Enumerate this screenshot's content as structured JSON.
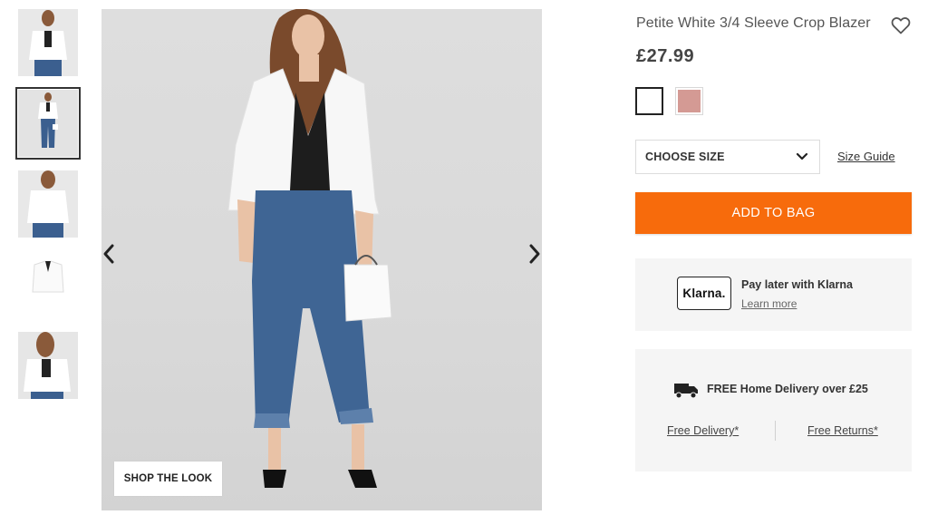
{
  "product": {
    "title": "Petite White 3/4 Sleeve Crop Blazer",
    "price": "£27.99",
    "colors": [
      {
        "name": "white",
        "hex": "#ffffff",
        "selected": true
      },
      {
        "name": "pink",
        "hex": "#d49a94",
        "selected": false
      }
    ]
  },
  "gallery": {
    "shop_the_look": "SHOP THE LOOK",
    "selected_thumbnail": 2,
    "thumbnail_count": 5
  },
  "size": {
    "select_label": "CHOOSE SIZE",
    "guide_link": "Size Guide"
  },
  "actions": {
    "add_to_bag": "ADD TO BAG"
  },
  "klarna": {
    "logo": "Klarna.",
    "title": "Pay later with Klarna",
    "link": "Learn more"
  },
  "delivery": {
    "title": "FREE Home Delivery over £25",
    "free_delivery_link": "Free Delivery*",
    "free_returns_link": "Free Returns*"
  },
  "colors": {
    "accent": "#f76b0c",
    "panel_bg": "#f5f5f5"
  }
}
